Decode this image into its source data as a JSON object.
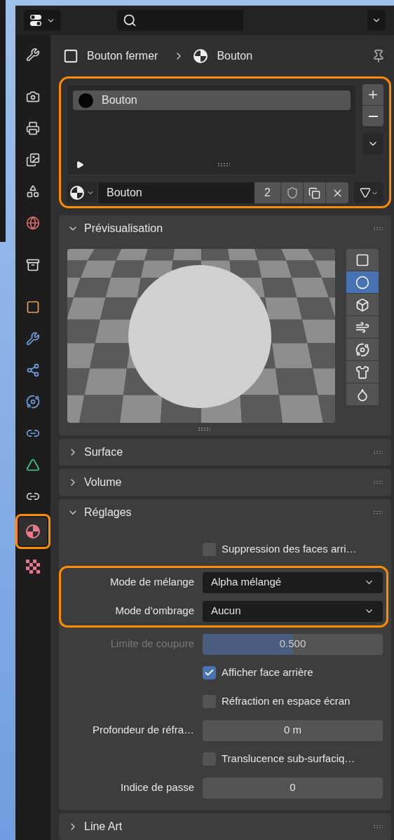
{
  "sidebar": {
    "groups": [
      [
        {
          "kind": "tool",
          "selected": false
        }
      ],
      [
        {
          "kind": "render",
          "selected": false
        },
        {
          "kind": "output",
          "selected": false
        },
        {
          "kind": "view_layer",
          "selected": false
        },
        {
          "kind": "scene",
          "selected": false
        },
        {
          "kind": "world",
          "selected": false
        }
      ],
      [
        {
          "kind": "collection",
          "selected": false
        }
      ],
      [
        {
          "kind": "object",
          "selected": false
        },
        {
          "kind": "modifier",
          "selected": false
        },
        {
          "kind": "particles",
          "selected": false
        },
        {
          "kind": "physics",
          "selected": false
        },
        {
          "kind": "constraints",
          "selected": false
        },
        {
          "kind": "data",
          "selected": false
        },
        {
          "kind": "shaderfx",
          "selected": false
        },
        {
          "kind": "material",
          "selected": true,
          "highlighted": true
        },
        {
          "kind": "texture",
          "selected": false
        }
      ]
    ]
  },
  "breadcrumb": [
    "Bouton fermer",
    "Bouton"
  ],
  "slots": {
    "highlighted": true,
    "items": [
      {
        "name": "Bouton",
        "selected": true
      }
    ],
    "material_name": "Bouton",
    "users": "2"
  },
  "preview": {
    "title": "Prévisualisation",
    "expanded": true,
    "shapes": [
      {
        "kind": "flat",
        "selected": false
      },
      {
        "kind": "sphere",
        "selected": true
      },
      {
        "kind": "cube",
        "selected": false
      },
      {
        "kind": "hair",
        "selected": false
      },
      {
        "kind": "shaderball",
        "selected": false
      },
      {
        "kind": "cloth",
        "selected": false
      },
      {
        "kind": "fluid",
        "selected": false
      }
    ]
  },
  "panels": [
    {
      "title": "Surface",
      "expanded": false
    },
    {
      "title": "Volume",
      "expanded": false
    }
  ],
  "settings": {
    "title": "Réglages",
    "expanded": true,
    "groups": [
      {
        "highlighted": false,
        "rows": [
          {
            "kind": "checkbox",
            "label": "Suppression des faces arri…",
            "checked": false
          }
        ]
      },
      {
        "highlighted": true,
        "rows": [
          {
            "kind": "select",
            "label": "Mode de mélange",
            "value": "Alpha mélangé"
          },
          {
            "kind": "select",
            "label": "Mode d’ombrage",
            "value": "Aucun"
          }
        ]
      },
      {
        "highlighted": false,
        "rows": [
          {
            "kind": "slider",
            "label": "Limite de coupure",
            "value": "0.500",
            "level": 0.5,
            "disabled": true
          },
          {
            "kind": "checkbox",
            "label": "Afficher face arrière",
            "checked": true
          },
          {
            "kind": "checkbox",
            "label": "Réfraction en espace écran",
            "checked": false
          },
          {
            "kind": "number",
            "label": "Profondeur de réfra…",
            "value": "0 m"
          },
          {
            "kind": "checkbox",
            "label": "Translucence sub-surfaciq…",
            "checked": false
          },
          {
            "kind": "number",
            "label": "Indice de passe",
            "value": "0"
          }
        ]
      }
    ]
  },
  "bottom_panels": [
    {
      "title": "Line Art",
      "expanded": false
    }
  ]
}
